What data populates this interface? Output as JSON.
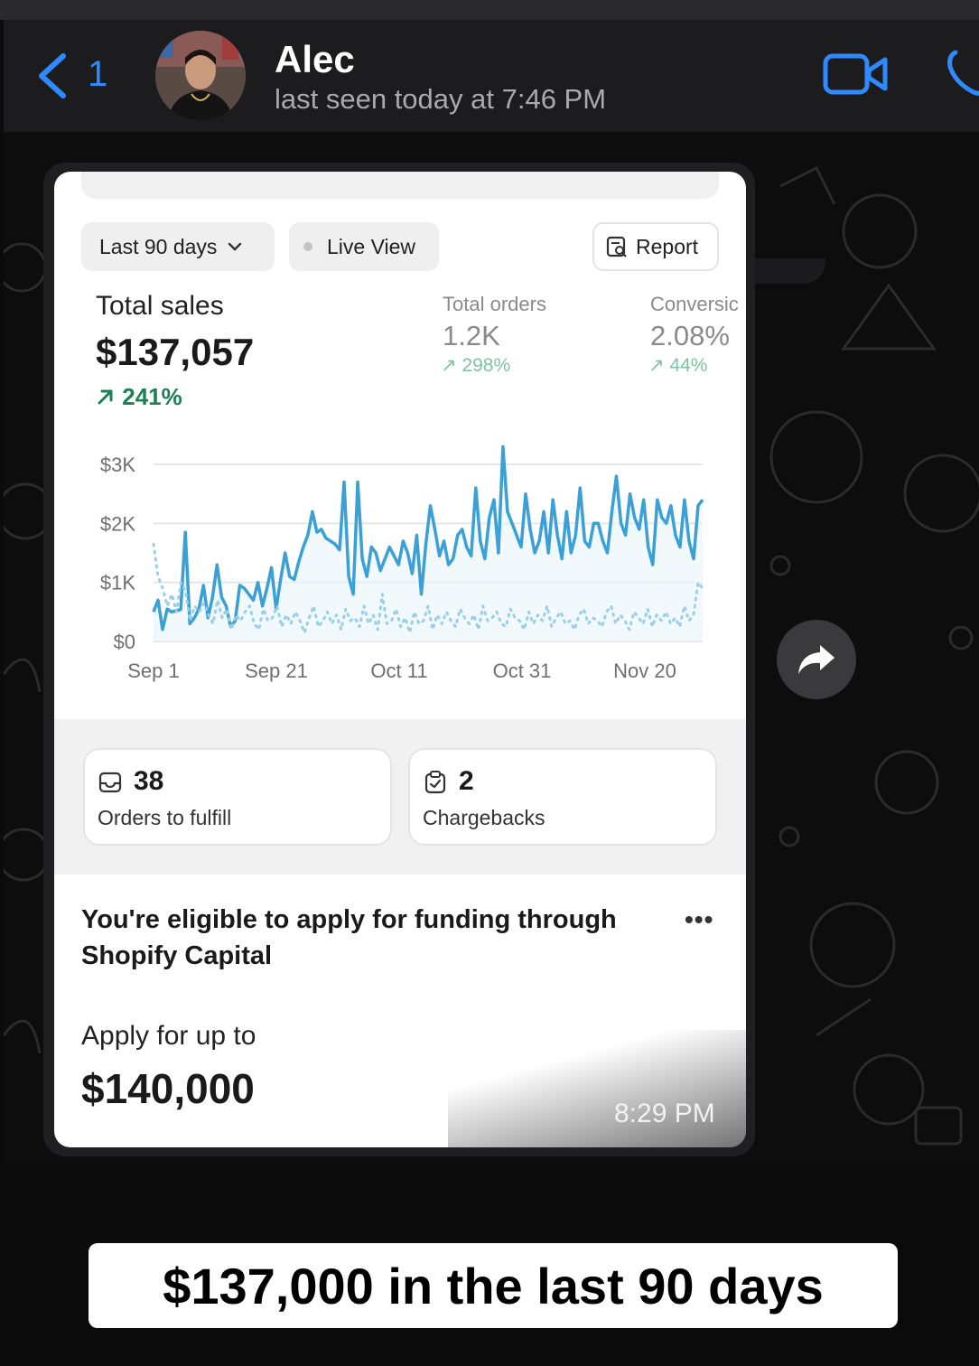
{
  "chat": {
    "back_count": "1",
    "contact_name": "Alec",
    "last_seen": "last seen today at 7:46 PM",
    "message_time": "8:29 PM"
  },
  "dashboard": {
    "period_label": "Last 90 days",
    "live_view_label": "Live View",
    "report_label": "Report",
    "total_sales": {
      "label": "Total sales",
      "value": "$137,057",
      "change": "241%"
    },
    "total_orders": {
      "label": "Total orders",
      "value": "1.2K",
      "change": "298%"
    },
    "conversion": {
      "label": "Conversic",
      "value": "2.08%",
      "change": "44%"
    },
    "orders_to_fulfill": {
      "count": "38",
      "label": "Orders to fulfill"
    },
    "chargebacks": {
      "count": "2",
      "label": "Chargebacks"
    },
    "capital": {
      "title": "You're eligible to apply for funding through Shopify Capital",
      "more": "•••",
      "apply_label": "Apply for up to",
      "apply_value": "$140,000"
    }
  },
  "colors": {
    "accent_blue": "#2f89ff",
    "series_current": "#3ba0d6",
    "series_previous": "#9bcfe6",
    "positive_green": "#1d7f53"
  },
  "chart_data": {
    "type": "line",
    "y_tick_labels": [
      "$3K",
      "$2K",
      "$1K",
      "$0"
    ],
    "x_tick_labels": [
      "Sep 1",
      "Sep 21",
      "Oct 11",
      "Oct 31",
      "Nov 20"
    ],
    "ylim": [
      0,
      3000
    ],
    "grid": true,
    "series": [
      {
        "style": "solid",
        "values": [
          500,
          700,
          200,
          550,
          500,
          520,
          540,
          1850,
          300,
          400,
          550,
          950,
          400,
          750,
          1300,
          750,
          600,
          250,
          350,
          950,
          900,
          800,
          700,
          1000,
          600,
          900,
          1250,
          550,
          1050,
          1500,
          1100,
          1050,
          1350,
          1600,
          1800,
          2200,
          1850,
          1900,
          1750,
          1700,
          1650,
          1550,
          2700,
          1100,
          800,
          2700,
          1400,
          1100,
          1600,
          1500,
          1200,
          1400,
          1600,
          1450,
          1300,
          1700,
          1500,
          1150,
          1800,
          800,
          1650,
          2300,
          1900,
          1450,
          1700,
          1300,
          1400,
          1800,
          1900,
          1600,
          1450,
          2600,
          1700,
          1400,
          2100,
          2400,
          1500,
          3300,
          2200,
          2000,
          1800,
          1600,
          2500,
          1900,
          1500,
          1700,
          2200,
          1500,
          2400,
          1800,
          1400,
          2200,
          1500,
          1800,
          2600,
          1700,
          1600,
          2000,
          2000,
          1700,
          1500,
          2200,
          2800,
          2000,
          1800,
          2500,
          2100,
          1900,
          2400,
          1600,
          1300,
          2400,
          2100,
          2000,
          2300,
          1800,
          1600,
          2400,
          1700,
          1400,
          2300,
          2400
        ]
      },
      {
        "style": "dotted",
        "values": [
          1650,
          1100,
          900,
          600,
          800,
          500,
          1000,
          850,
          350,
          600,
          500,
          650,
          450,
          300,
          700,
          400,
          550,
          200,
          450,
          350,
          500,
          600,
          300,
          200,
          550,
          350,
          400,
          600,
          250,
          450,
          300,
          500,
          350,
          150,
          400,
          600,
          250,
          350,
          500,
          300,
          450,
          200,
          550,
          350,
          400,
          250,
          600,
          300,
          450,
          200,
          800,
          300,
          350,
          550,
          250,
          400,
          150,
          500,
          300,
          350,
          600,
          200,
          450,
          300,
          500,
          350,
          250,
          550,
          400,
          300,
          450,
          200,
          600,
          350,
          400,
          500,
          300,
          250,
          550,
          400,
          350,
          200,
          500,
          300,
          450,
          350,
          600,
          250,
          400,
          500,
          300,
          350,
          200,
          450,
          550,
          300,
          400,
          350,
          250,
          500,
          600,
          300,
          450,
          350,
          200,
          500,
          400,
          300,
          550,
          250,
          450,
          350,
          500,
          300,
          400,
          250,
          600,
          350,
          450,
          1000,
          900
        ]
      }
    ]
  },
  "caption": "$137,000 in the last 90 days"
}
